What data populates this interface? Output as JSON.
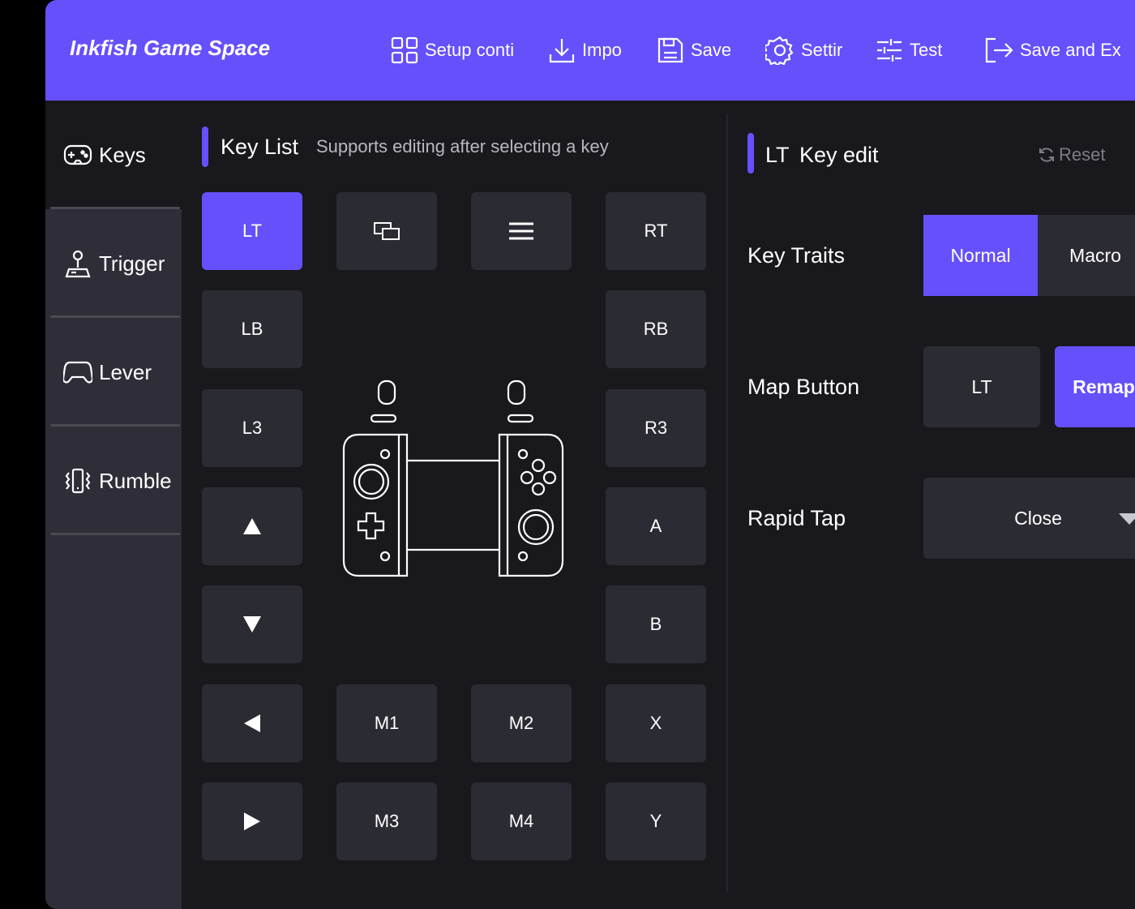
{
  "app": {
    "title": "Inkfish Game Space"
  },
  "toolbar": {
    "setup": "Setup conti",
    "import": "Impo",
    "save": "Save",
    "settings": "Settir",
    "test": "Test",
    "save_exit": "Save and Exi"
  },
  "sidebar": {
    "items": [
      {
        "label": "Keys",
        "icon": "gamepad-icon"
      },
      {
        "label": "Trigger",
        "icon": "joystick-icon"
      },
      {
        "label": "Lever",
        "icon": "controller-icon"
      },
      {
        "label": "Rumblе",
        "icon": "vibration-icon"
      }
    ]
  },
  "key_list": {
    "title": "Key List",
    "subtitle": "Supports editing after selecting a key",
    "keys": {
      "lt": "LT",
      "rt": "RT",
      "lb": "LB",
      "rb": "RB",
      "l3": "L3",
      "r3": "R3",
      "a": "A",
      "b": "B",
      "x": "X",
      "y": "Y",
      "m1": "M1",
      "m2": "M2",
      "m3": "M3",
      "m4": "M4"
    }
  },
  "key_edit": {
    "key": "LT",
    "title": "Key edit",
    "reset": "Reset",
    "traits_label": "Key Traits",
    "traits": [
      "Normal",
      "Macro"
    ],
    "selected_trait": "Normal",
    "map_label": "Map Button",
    "map_value": "LT",
    "remap": "Remap",
    "rapid_label": "Rapid Tap",
    "rapid_value": "Close"
  },
  "colors": {
    "accent": "#6650fb",
    "panel": "#19191d",
    "tile": "#2b2b33",
    "sidebar": "#2f2e38"
  }
}
